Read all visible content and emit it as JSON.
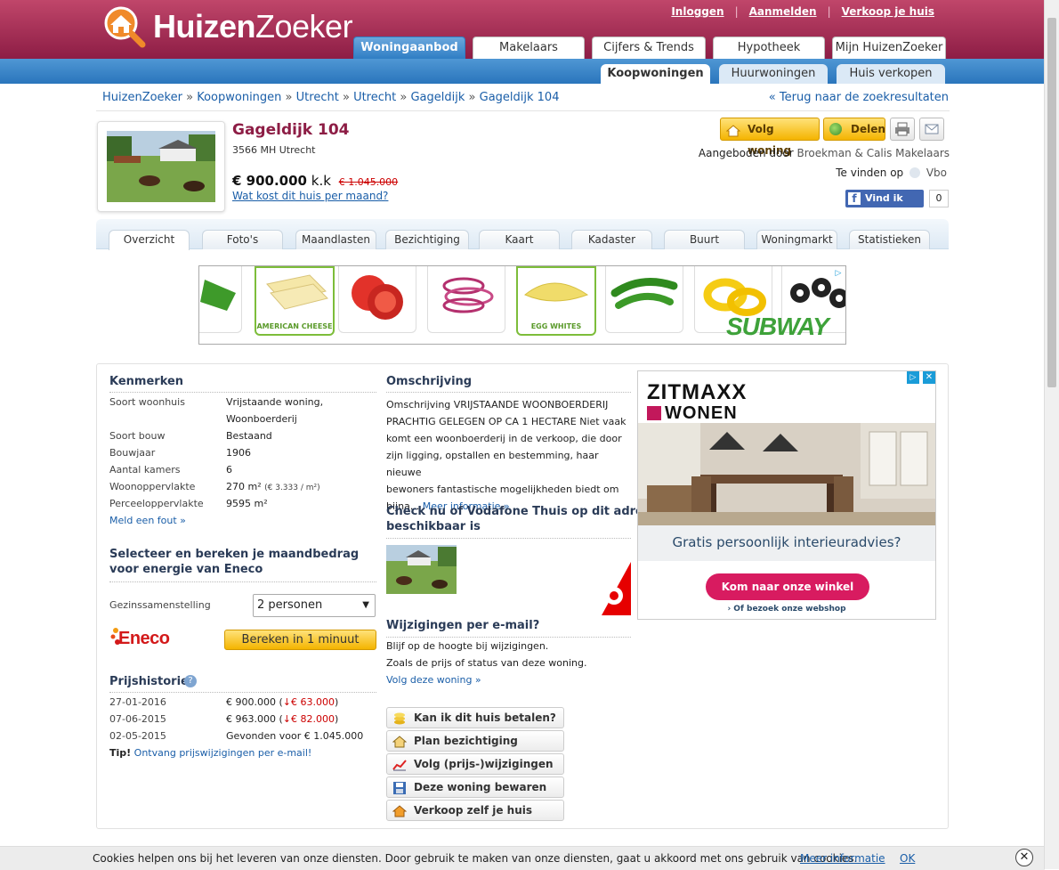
{
  "header": {
    "logo_text_bold": "Huizen",
    "logo_text_regular": "Zoeker",
    "top_links": [
      "Inloggen",
      "Aanmelden",
      "Verkoop je huis"
    ],
    "main_tabs": [
      "Woningaanbod",
      "Makelaars",
      "Cijfers & Trends",
      "Hypotheek",
      "Mijn HuizenZoeker"
    ],
    "sub_tabs": [
      "Koopwoningen",
      "Huurwoningen",
      "Huis verkopen"
    ]
  },
  "breadcrumb": {
    "items": [
      "HuizenZoeker",
      "Koopwoningen",
      "Utrecht",
      "Utrecht",
      "Gageldijk",
      "Gageldijk 104"
    ],
    "separator": "»",
    "back_link": "« Terug naar de zoekresultaten"
  },
  "listing": {
    "address": "Gageldijk 104",
    "postcode": "3566 MH Utrecht",
    "price": "€ 900.000",
    "price_suffix": "k.k",
    "old_price": "€ 1.045.000",
    "monthly_link": "Wat kost dit huis per maand?",
    "follow_button": "Volg woning",
    "share_button": "Delen",
    "offered_by_label": "Aangeboden door",
    "offered_by_agent": "Broekman & Calis Makelaars",
    "find_on_label": "Te vinden op",
    "find_on_source": "Vbo",
    "fb_like": "Vind ik leuk",
    "fb_count": "0"
  },
  "detail_tabs": [
    "Overzicht",
    "Foto's",
    "Maandlasten",
    "Bezichtiging",
    "Kaart",
    "Kadaster",
    "Buurt",
    "Woningmarkt",
    "Statistieken"
  ],
  "ad_banner": {
    "labels": [
      "AMERICAN CHEESE",
      "EGG WHITES"
    ],
    "brand": "SUBWAY"
  },
  "kenmerken": {
    "title": "Kenmerken",
    "rows": [
      {
        "label": "Soort woonhuis",
        "value": "Vrijstaande woning,"
      },
      {
        "label": "",
        "value": "Woonboerderij"
      },
      {
        "label": "Soort bouw",
        "value": "Bestaand"
      },
      {
        "label": "Bouwjaar",
        "value": "1906"
      },
      {
        "label": "Aantal kamers",
        "value": "6"
      },
      {
        "label": "Woonoppervlakte",
        "value": "270 m²"
      },
      {
        "label": "Perceeloppervlakte",
        "value": "9595 m²"
      }
    ],
    "price_per_m2": "(€ 3.333 / m²)",
    "report_link": "Meld een fout »"
  },
  "energy": {
    "title_line1": "Selecteer en bereken je maandbedrag",
    "title_line2": "voor energie van Eneco",
    "household_label": "Gezinssamenstelling",
    "household_value": "2 personen",
    "brand": "Eneco",
    "calc_button": "Bereken in 1 minuut"
  },
  "price_history": {
    "title": "Prijshistorie",
    "rows": [
      {
        "date": "27-01-2016",
        "price": "€ 900.000 (",
        "change": "€ 63.000",
        "close": ")"
      },
      {
        "date": "07-06-2015",
        "price": "€ 963.000 (",
        "change": "€ 82.000",
        "close": ")"
      },
      {
        "date": "02-05-2015",
        "price": "Gevonden voor € 1.045.000",
        "change": "",
        "close": ""
      }
    ],
    "tip_label": "Tip!",
    "tip_link": "Ontvang prijswijzigingen per e-mail!"
  },
  "description": {
    "title": "Omschrijving",
    "lines": [
      "Omschrijving VRIJSTAANDE WOONBOERDERIJ",
      "PRACHTIG GELEGEN OP CA 1 HECTARE Niet vaak",
      "komt een woonboerderij in de verkoop, die door",
      "zijn ligging, opstallen en bestemming, haar nieuwe",
      "bewoners fantastische mogelijkheden biedt om"
    ],
    "last_line": "bijna...",
    "more_link": "Meer informatie »"
  },
  "vodafone": {
    "title_line1": "Check nu of Vodafone Thuis op dit adres",
    "title_line2": "beschikbaar is"
  },
  "email_updates": {
    "title": "Wijzigingen per e-mail?",
    "line1": "Blijf op de hoogte bij wijzigingen.",
    "line2": "Zoals de prijs of status van deze woning.",
    "link": "Volg deze woning »"
  },
  "actions": [
    "Kan ik dit huis betalen?",
    "Plan bezichtiging",
    "Volg (prijs-)wijzigingen",
    "Deze woning bewaren",
    "Verkoop zelf je huis"
  ],
  "side_ad": {
    "brand_line1": "ZITMAXX",
    "brand_line2": "WONEN",
    "headline": "Gratis persoonlijk interieuradvies?",
    "cta": "Kom naar onze winkel",
    "sub_link": "› Of bezoek onze webshop"
  },
  "cookie_bar": {
    "text": "Cookies helpen ons bij het leveren van onze diensten. Door gebruik te maken van onze diensten, gaat u akkoord met ons gebruik van cookies.",
    "more_link": "Meer informatie",
    "ok": "OK"
  },
  "colors": {
    "brand": "#a22a55",
    "nav_blue": "#2f7ec4",
    "link": "#1a5ea8",
    "price_drop": "#cc0000"
  }
}
